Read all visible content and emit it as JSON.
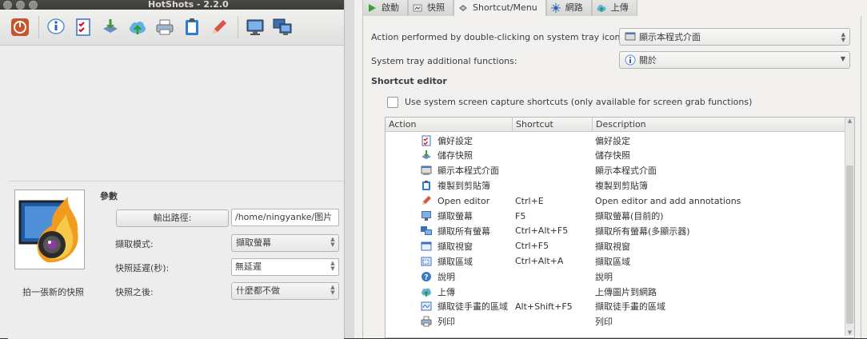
{
  "window": {
    "title": "HotShots - 2.2.0"
  },
  "toolbar": {
    "icons": [
      "power-icon",
      "info-icon",
      "checklist-icon",
      "save-icon",
      "upload-cloud-icon",
      "printer-icon",
      "clipboard-icon",
      "pencil-icon",
      "monitor-icon",
      "multi-monitor-icon"
    ]
  },
  "left_panel": {
    "take_snapshot_label": "拍一張新的快照",
    "params_title": "參數",
    "output_path_button": "輸出路徑:",
    "output_path_value": "/home/ningyanke/图片",
    "capture_mode_label": "擷取模式:",
    "capture_mode_value": "擷取螢幕",
    "delay_label": "快照延遲(秒):",
    "delay_value": "無延遲",
    "after_label": "快照之後:",
    "after_value": "什麼都不做"
  },
  "settings": {
    "tabs": [
      {
        "label": "啟動",
        "icon": "play-icon"
      },
      {
        "label": "快照",
        "icon": "snapshot-icon"
      },
      {
        "label": "Shortcut/Menu",
        "icon": "shortcut-icon"
      },
      {
        "label": "網路",
        "icon": "network-icon"
      },
      {
        "label": "上傳",
        "icon": "upload-icon"
      }
    ],
    "active_tab": "Shortcut/Menu",
    "double_click_label": "Action performed by double-clicking on system tray icon:",
    "double_click_value": "顯示本程式介面",
    "tray_functions_label": "System tray additional functions:",
    "tray_functions_value": "關於",
    "shortcut_editor_title": "Shortcut editor",
    "use_system_shortcuts_label": "Use system  screen capture shortcuts (only available for screen grab functions)",
    "use_system_shortcuts_checked": false,
    "table": {
      "headers": [
        "Action",
        "Shortcut",
        "Description"
      ],
      "rows": [
        {
          "action": "偏好設定",
          "shortcut": "",
          "description": "偏好設定",
          "icon": "checklist-icon"
        },
        {
          "action": "儲存快照",
          "shortcut": "",
          "description": "儲存快照",
          "icon": "save-icon"
        },
        {
          "action": "顯示本程式介面",
          "shortcut": "",
          "description": "顯示本程式介面",
          "icon": "app-window-icon"
        },
        {
          "action": "複製到剪貼簿",
          "shortcut": "",
          "description": "複製到剪貼簿",
          "icon": "clipboard-icon"
        },
        {
          "action": "Open editor",
          "shortcut": "Ctrl+E",
          "description": "Open  editor and add annotations",
          "icon": "pencil-icon"
        },
        {
          "action": "擷取螢幕",
          "shortcut": "F5",
          "description": "擷取螢幕(目前的)",
          "icon": "monitor-icon"
        },
        {
          "action": "擷取所有螢幕",
          "shortcut": "Ctrl+Alt+F5",
          "description": "擷取所有螢幕(多顯示器)",
          "icon": "multi-monitor-icon"
        },
        {
          "action": "擷取視窗",
          "shortcut": "Ctrl+F5",
          "description": "擷取視窗",
          "icon": "window-icon"
        },
        {
          "action": "擷取區域",
          "shortcut": "Ctrl+Alt+A",
          "description": "擷取區域",
          "icon": "region-icon"
        },
        {
          "action": "說明",
          "shortcut": "",
          "description": "說明",
          "icon": "help-icon"
        },
        {
          "action": "上傳",
          "shortcut": "",
          "description": "上傳圖片到網路",
          "icon": "upload-cloud-icon"
        },
        {
          "action": "擷取徒手畫的區域",
          "shortcut": "Alt+Shift+F5",
          "description": "擷取徒手畫的區域",
          "icon": "freehand-icon"
        },
        {
          "action": "列印",
          "shortcut": "",
          "description": "列印",
          "icon": "printer-icon"
        }
      ]
    }
  }
}
